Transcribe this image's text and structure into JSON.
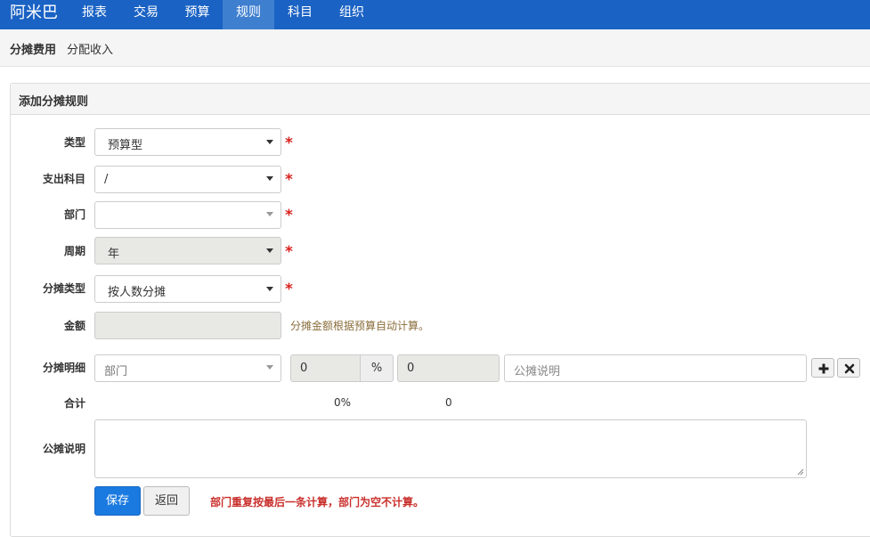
{
  "navbar": {
    "brand": "阿米巴",
    "items": [
      {
        "label": "报表"
      },
      {
        "label": "交易"
      },
      {
        "label": "预算"
      },
      {
        "label": "规则"
      },
      {
        "label": "科目"
      },
      {
        "label": "组织"
      }
    ],
    "active": "规则"
  },
  "subnav": {
    "items": [
      {
        "label": "分摊费用"
      },
      {
        "label": "分配收入"
      }
    ]
  },
  "panel": {
    "title": "添加分摊规则"
  },
  "form": {
    "type": {
      "label": "类型",
      "value": "预算型"
    },
    "expense_account": {
      "label": "支出科目",
      "value": "/"
    },
    "department": {
      "label": "部门",
      "value": ""
    },
    "period": {
      "label": "周期",
      "value": "年"
    },
    "allocation_type": {
      "label": "分摊类型",
      "value": "按人数分摊"
    },
    "amount": {
      "label": "金额",
      "value": "",
      "hint": "分摊金额根据预算自动计算。"
    },
    "detail": {
      "label": "分摊明细",
      "department_placeholder": "部门",
      "percent_value": "0",
      "percent_unit": "%",
      "amount_value": "0",
      "note_placeholder": "公摊说明"
    },
    "total": {
      "label": "合计",
      "percent": "0%",
      "amount": "0"
    },
    "note": {
      "label": "公摊说明",
      "value": ""
    },
    "required_mark": "*",
    "save_label": "保存",
    "back_label": "返回",
    "warning": "部门重复按最后一条计算，部门为空不计算。"
  },
  "colors": {
    "navbar": "#1a62c4",
    "nav_active": "#3f7fd0",
    "primary_button": "#1a7ae0",
    "required": "#d9231f",
    "hint": "#8a6d3b",
    "warning": "#c9302c"
  }
}
